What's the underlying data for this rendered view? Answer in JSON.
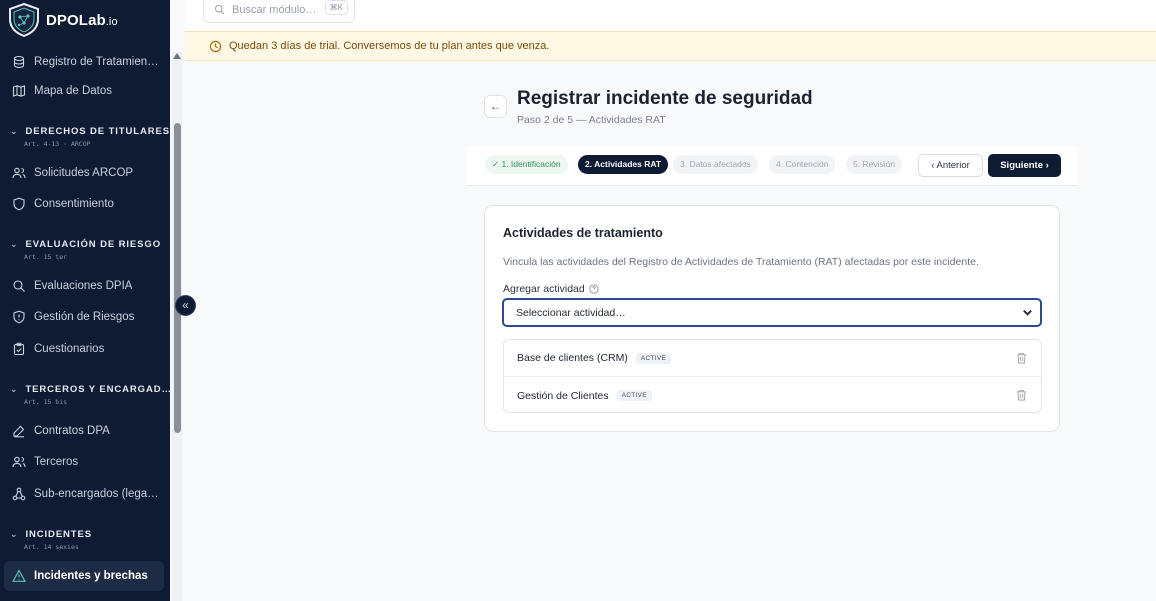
{
  "brand": {
    "name": "DPOLab",
    "suffix": ".io"
  },
  "sidebar": {
    "items": [
      {
        "id": "registro",
        "label": "Registro de Tratamientos",
        "icon": "database-icon"
      },
      {
        "id": "mapa",
        "label": "Mapa de Datos",
        "icon": "map-icon"
      },
      {
        "id": "solicitudes",
        "label": "Solicitudes ARCOP",
        "icon": "users-icon"
      },
      {
        "id": "consentimiento",
        "label": "Consentimiento",
        "icon": "shield-icon"
      },
      {
        "id": "dpia",
        "label": "Evaluaciones DPIA",
        "icon": "search-icon"
      },
      {
        "id": "riesgos",
        "label": "Gestión de Riesgos",
        "icon": "shield-alert-icon"
      },
      {
        "id": "cuestionarios",
        "label": "Cuestionarios",
        "icon": "clipboard-icon"
      },
      {
        "id": "contratos",
        "label": "Contratos DPA",
        "icon": "pen-icon"
      },
      {
        "id": "terceros",
        "label": "Terceros",
        "icon": "users-icon"
      },
      {
        "id": "subencargados",
        "label": "Sub-encargados (legad…",
        "icon": "network-icon"
      },
      {
        "id": "incidentes",
        "label": "Incidentes y brechas",
        "icon": "alert-triangle-icon",
        "active": true
      }
    ],
    "sections": [
      {
        "title": "DERECHOS DE TITULARES",
        "sub": "Art. 4-13 · ARCOP"
      },
      {
        "title": "EVALUACIÓN DE RIESGO",
        "sub": "Art. 15 ter"
      },
      {
        "title": "TERCEROS Y ENCARGAD…",
        "sub": "Art. 15 bis"
      },
      {
        "title": "INCIDENTES",
        "sub": "Art. 14 sexies"
      }
    ]
  },
  "search": {
    "placeholder": "Buscar módulo…",
    "shortcut": "⌘K"
  },
  "trial": {
    "message": "Quedan 3 días de trial. Conversemos de tu plan antes que venza."
  },
  "page": {
    "title": "Registrar incidente de seguridad",
    "subtitle": "Paso 2 de 5 — Actividades RAT"
  },
  "steps": [
    {
      "label": "✓ 1. Identificación",
      "state": "done"
    },
    {
      "label": "2. Actividades RAT",
      "state": "current"
    },
    {
      "label": "3. Datos afectados",
      "state": "todo"
    },
    {
      "label": "4. Contención",
      "state": "todo"
    },
    {
      "label": "5. Revisión",
      "state": "todo"
    }
  ],
  "nav_buttons": {
    "prev": "‹  Anterior",
    "next": "Siguiente  ›"
  },
  "card": {
    "title": "Actividades de tratamiento",
    "description": "Vincula las actividades del Registro de Actividades de Tratamiento (RAT) afectadas por este incidente.",
    "field_label": "Agregar actividad",
    "select_value": "Seleccionar actividad…",
    "activities": [
      {
        "name": "Base de clientes (CRM)",
        "status": "ACTIVE"
      },
      {
        "name": "Gestión de Clientes",
        "status": "ACTIVE"
      }
    ]
  },
  "colors": {
    "sidebar": "#0f1b33",
    "accent": "#2b4a8f",
    "trial_bg": "#fff8e5",
    "success": "#2f8f5b"
  }
}
